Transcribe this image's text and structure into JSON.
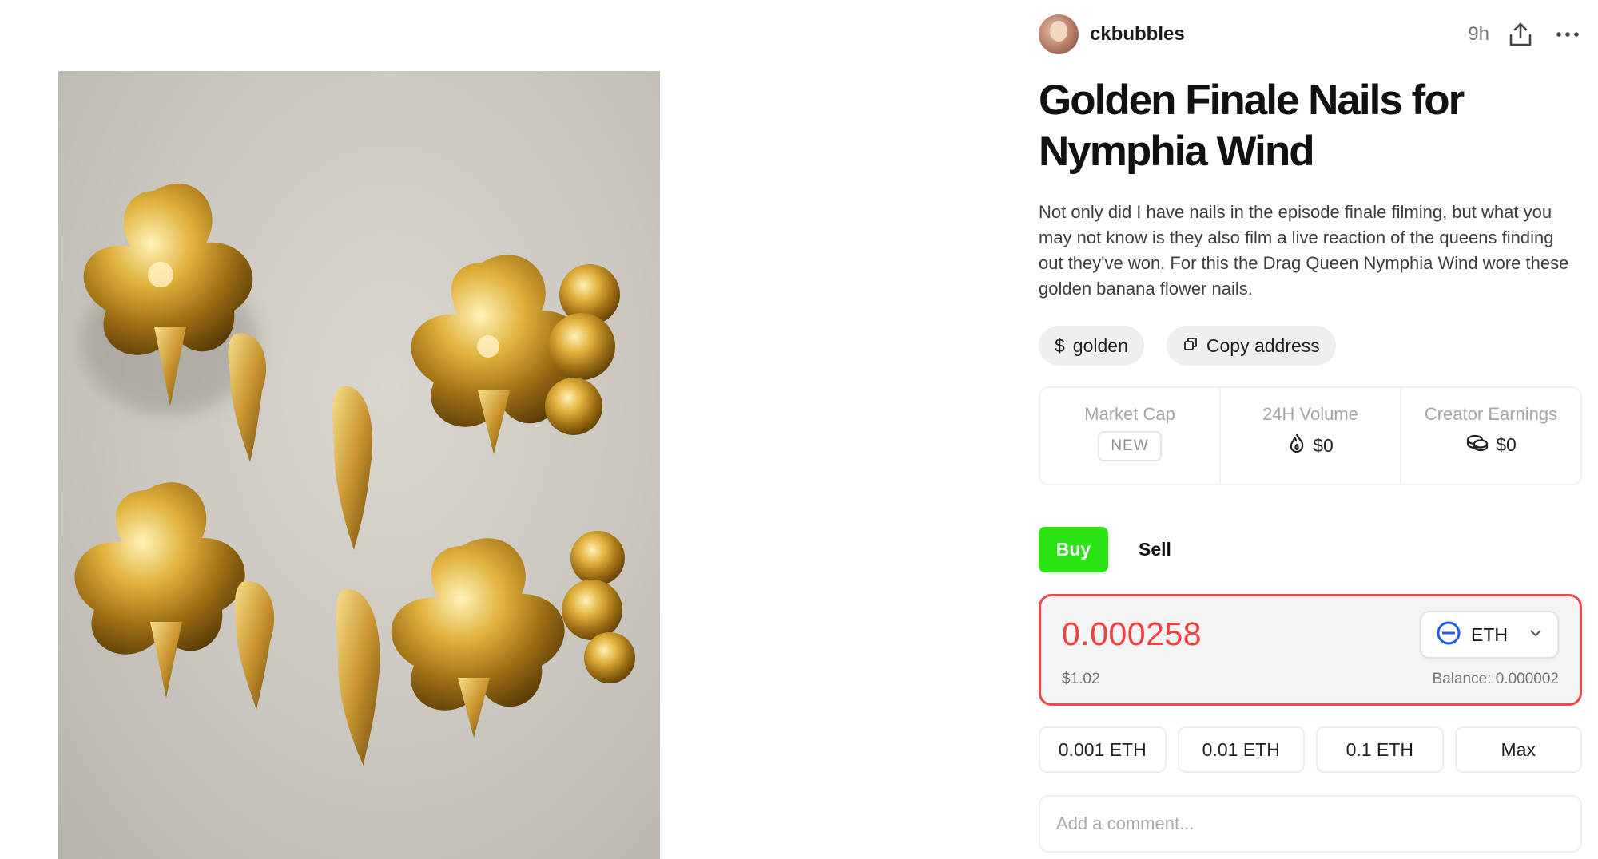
{
  "post": {
    "author": "ckbubbles",
    "time": "9h",
    "title": "Golden Finale Nails for Nymphia Wind",
    "description": "Not only did I have nails in the episode finale filming, but what you may not know is they also film a live reaction of the queens finding out they've won. For this the Drag Queen Nymphia Wind wore these golden banana flower nails.",
    "ticker": "golden",
    "copy_label": "Copy address"
  },
  "stats": {
    "market_cap_label": "Market Cap",
    "market_cap_value": "NEW",
    "volume_label": "24H Volume",
    "volume_value": "$0",
    "earnings_label": "Creator Earnings",
    "earnings_value": "$0"
  },
  "trade": {
    "buy_label": "Buy",
    "sell_label": "Sell",
    "amount": "0.000258",
    "amount_usd": "$1.02",
    "token": "ETH",
    "balance": "Balance: 0.000002",
    "quick": [
      "0.001 ETH",
      "0.01 ETH",
      "0.1 ETH",
      "Max"
    ]
  },
  "comment": {
    "placeholder": "Add a comment..."
  },
  "colors": {
    "buy_green": "#2be312",
    "amount_red": "#f0403f",
    "border_red": "#ee4848",
    "eth_blue": "#1f5cf0"
  }
}
